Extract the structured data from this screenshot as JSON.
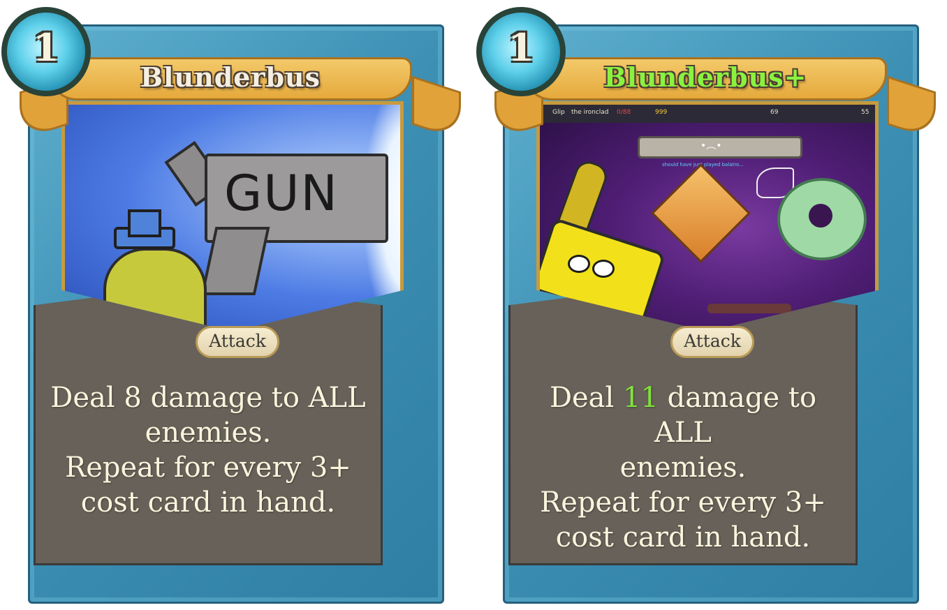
{
  "cards": [
    {
      "cost": "1",
      "title": "Blunderbus",
      "type": "Attack",
      "art_text": "GUN",
      "description": {
        "line1_pre": "Deal ",
        "damage": "8",
        "line1_post": " damage to ALL",
        "line2": "enemies.",
        "line3": "Repeat for every 3+",
        "line4": "cost card in hand."
      }
    },
    {
      "cost": "1",
      "title": "Blunderbus+",
      "type": "Attack",
      "description": {
        "line1_pre": "Deal ",
        "damage": "11",
        "line1_post": " damage to ALL",
        "line2": "enemies.",
        "line3": "Repeat for every 3+",
        "line4": "cost card in hand."
      },
      "art_hud": {
        "player_name": "Glip",
        "player_class": "the ironclad",
        "hp": "0/88",
        "gold": "999",
        "floor": "69",
        "deck_count": "55",
        "speech_face": "•︵•",
        "speech_caption": "should have just played balatro..."
      }
    }
  ],
  "colors": {
    "upgraded_title": "#8af23f",
    "upgraded_value": "#7fe23a",
    "frame_blue": "#3d8fb3",
    "banner_gold": "#e5a93c",
    "desc_box": "#676159"
  }
}
